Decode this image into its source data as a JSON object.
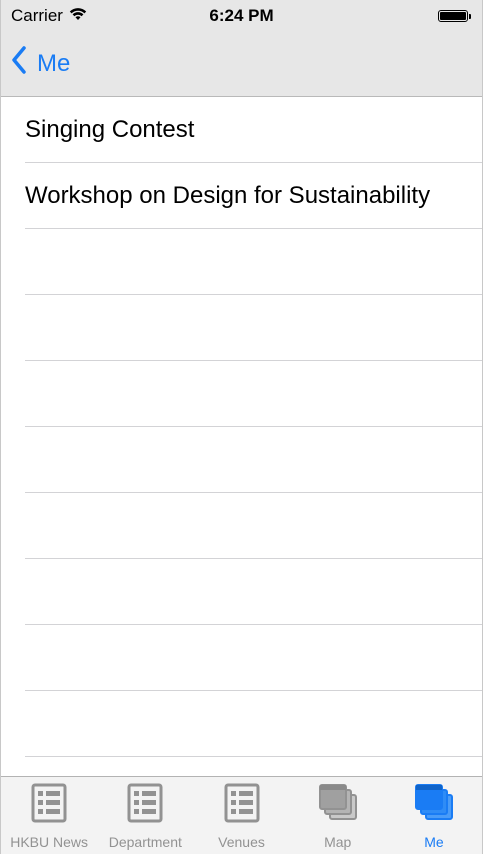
{
  "status_bar": {
    "carrier": "Carrier",
    "time": "6:24 PM",
    "battery_level": 1.0
  },
  "nav": {
    "back_label": "Me"
  },
  "list": {
    "items": [
      "Singing Contest",
      "Workshop on Design for Sustainability"
    ]
  },
  "tab_bar": {
    "tabs": [
      {
        "label": "HKBU News",
        "icon": "list-icon",
        "active": false
      },
      {
        "label": "Department",
        "icon": "list-icon",
        "active": false
      },
      {
        "label": "Venues",
        "icon": "list-icon",
        "active": false
      },
      {
        "label": "Map",
        "icon": "stacked-windows-icon",
        "active": false
      },
      {
        "label": "Me",
        "icon": "stacked-windows-icon",
        "active": true
      }
    ]
  },
  "colors": {
    "accent": "#1a7cf4",
    "inactive": "#929292"
  }
}
